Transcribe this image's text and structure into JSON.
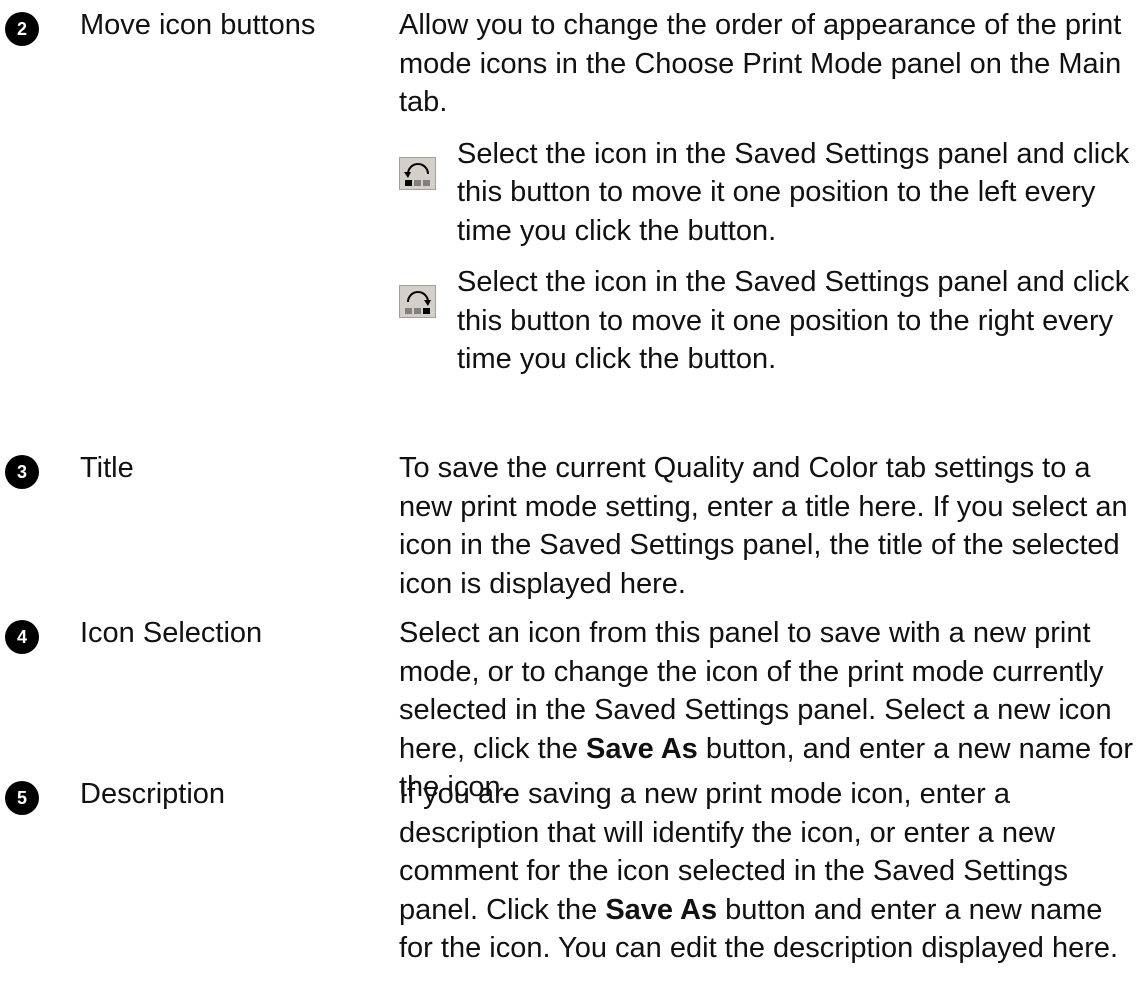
{
  "entries": [
    {
      "number": "2",
      "term": "Move icon buttons",
      "description": "Allow you to change the order of appearance of the print mode icons in the Choose Print Mode panel on the Main tab.",
      "sub_items": [
        {
          "icon": "move-left-icon",
          "text": "Select the icon in the Saved Settings panel and click this button to move it one position to the left every time you click the button."
        },
        {
          "icon": "move-right-icon",
          "text": "Select the icon in the Saved Settings panel and click this button to move it one position to the right every time you click the button."
        }
      ]
    },
    {
      "number": "3",
      "term": "Title",
      "description": "To save the current Quality and Color tab settings to a new print mode setting, enter a title here. If you select an icon in the Saved Settings panel, the title of the selected icon is displayed here."
    },
    {
      "number": "4",
      "term": "Icon Selection",
      "desc_part1": "Select an icon from this panel to save with a new print mode, or to change the icon of the print mode currently selected in the Saved Settings panel. Select a new icon here, click the ",
      "desc_bold": "Save As",
      "desc_part2": " button, and enter a new name for the icon."
    },
    {
      "number": "5",
      "term": "Description",
      "desc_part1": "If you are saving a new print mode icon, enter a description that will identify the icon, or enter a new comment for the icon selected in the Saved Settings panel. Click the ",
      "desc_bold": "Save As",
      "desc_part2": " button and enter a new name for the icon. You can edit the description displayed here."
    }
  ]
}
